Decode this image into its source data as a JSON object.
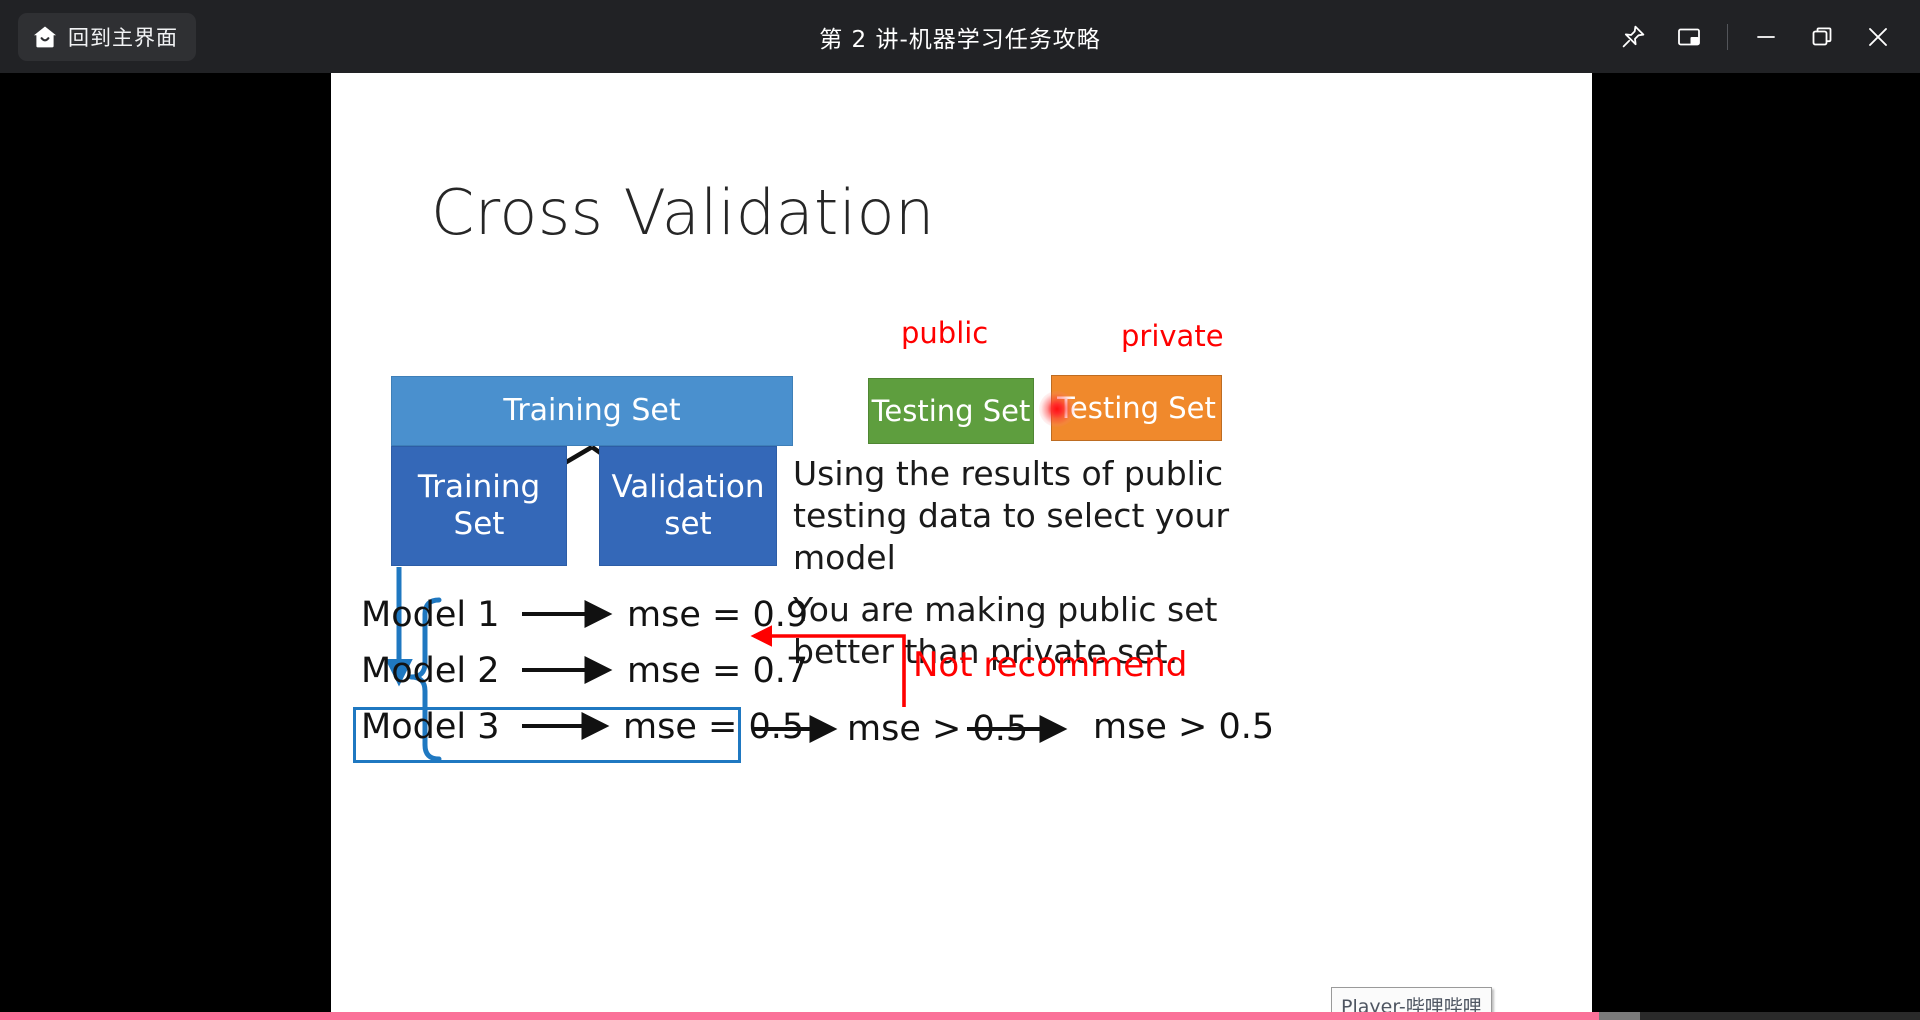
{
  "titlebar": {
    "home_button_label": "回到主界面",
    "home_icon": "house-icon",
    "window_title": "第 2 讲-机器学习任务攻略",
    "controls": [
      {
        "name": "pin-icon",
        "label": "Pin"
      },
      {
        "name": "picture-in-picture-icon",
        "label": "Picture in picture"
      },
      {
        "name": "minimize-icon",
        "label": "Minimize"
      },
      {
        "name": "maximize-icon",
        "label": "Restore"
      },
      {
        "name": "close-icon",
        "label": "Close"
      }
    ]
  },
  "slide": {
    "title": "Cross Validation",
    "boxes": {
      "training_all": "Training Set",
      "training_sub": "Training\nSet",
      "training_sub_line1": "Training",
      "training_sub_line2": "Set",
      "validation_line1": "Validation",
      "validation_line2": "set",
      "testing_public": "Testing Set",
      "testing_private": "Testing Set"
    },
    "labels": {
      "public": "public",
      "private": "private"
    },
    "body": {
      "line1": "Using the results of public testing data to select your model",
      "line2": "You are making public set better than private set."
    },
    "models": [
      {
        "name": "Model 1",
        "mse": "mse = 0.9"
      },
      {
        "name": "Model 2",
        "mse": "mse = 0.7"
      },
      {
        "name": "Model 3",
        "mse": "mse = 0.5"
      }
    ],
    "tail": {
      "mse_public": "mse > 0.5",
      "mse_private": "mse > 0.5"
    },
    "annotation": {
      "not_recommend": "Not recommend"
    },
    "colors": {
      "training_all": "#4a90ce",
      "training_sub": "#3468b8",
      "validation": "#3468b8",
      "testing_public": "#5e9e3e",
      "testing_private": "#f0892c",
      "red_label": "#ff0000",
      "highlight_border": "#1f78c1",
      "arrow_blue": "#1f78c1"
    }
  },
  "tooltip": {
    "text": "Player-哔哩哔哩"
  },
  "progress": {
    "played_percent": 83.3,
    "buffered_percent": 85.4,
    "accent": "#fb7299"
  }
}
